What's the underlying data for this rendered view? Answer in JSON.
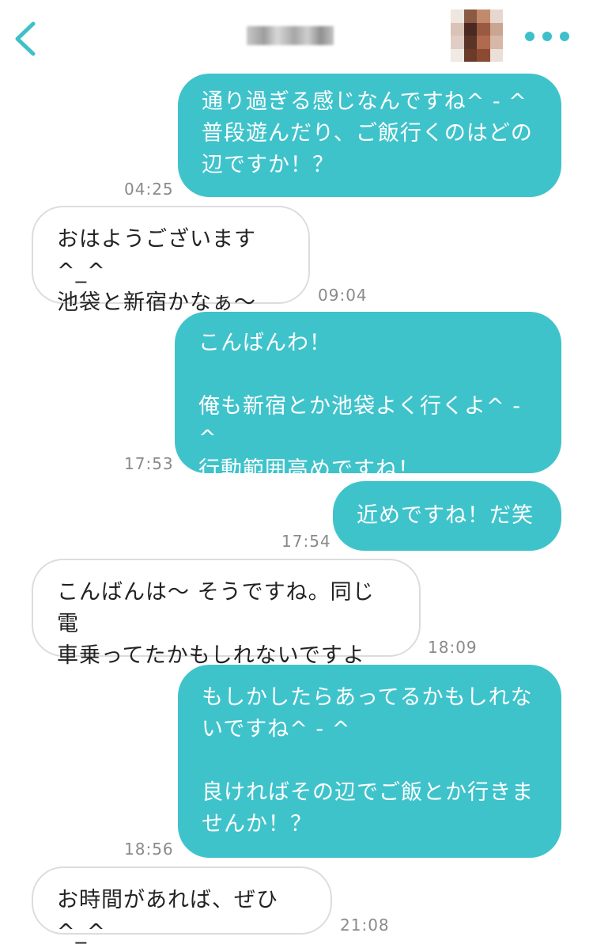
{
  "header": {
    "back_icon": "chevron-left-icon",
    "more_icon": "ellipsis-horizontal-icon",
    "accent_color": "#3ec0c9"
  },
  "messages": [
    {
      "direction": "out",
      "text": "通り過ぎる感じなんですね^ - ^\n普段遊んだり、ご飯行くのはどの\n辺ですか！？",
      "time": "04:25"
    },
    {
      "direction": "in",
      "text": "おはようございます^_^\n池袋と新宿かなぁ〜",
      "time": "09:04"
    },
    {
      "direction": "out",
      "text": "こんばんわ！\n\n俺も新宿とか池袋よく行くよ^ - ^\n行動範囲高めですね！",
      "time": "17:53"
    },
    {
      "direction": "out",
      "text": "近めですね！だ笑",
      "time": "17:54"
    },
    {
      "direction": "in",
      "text": "こんばんは〜 そうですね。同じ電\n車乗ってたかもしれないですよ",
      "time": "18:09"
    },
    {
      "direction": "out",
      "text": "もしかしたらあってるかもしれな\nいですね^ - ^\n\n良ければその辺でご飯とか行きま\nせんか！？",
      "time": "18:56"
    },
    {
      "direction": "in",
      "text": "お時間があれば、ぜひ^_^",
      "time": "21:08"
    }
  ],
  "colors": {
    "outgoing_bubble": "#3fc3cb",
    "incoming_border": "#dcdcdc",
    "timestamp": "#8a8a8a"
  }
}
